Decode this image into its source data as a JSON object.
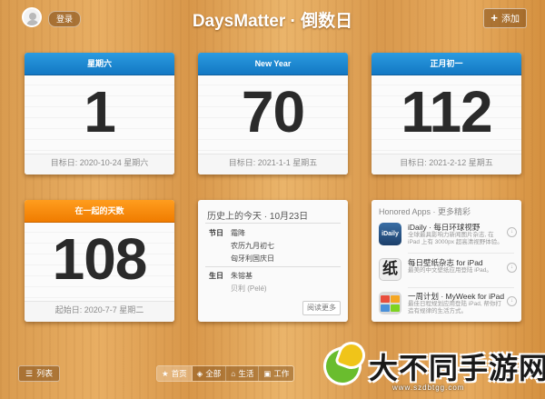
{
  "header": {
    "login_label": "登录",
    "title": "DaysMatter · 倒数日",
    "add_label": "添加"
  },
  "cards": [
    {
      "header": "星期六",
      "number": "1",
      "subtitle": "目标日: 2020-10-24 星期六",
      "color": "#1a86d2"
    },
    {
      "header": "New Year",
      "number": "70",
      "subtitle": "目标日: 2021-1-1 星期五",
      "color": "#1a86d2"
    },
    {
      "header": "正月初一",
      "number": "112",
      "subtitle": "目标日: 2021-2-12 星期五",
      "color": "#1a86d2"
    },
    {
      "header": "在一起的天数",
      "number": "108",
      "subtitle": "起始日: 2020-7-7 星期二",
      "color": "#f28500"
    }
  ],
  "history": {
    "title": "历史上的今天 · 10月23日",
    "festival_label": "节日",
    "festival_items": [
      "霜降",
      "农历九月初七",
      "匈牙利国庆日"
    ],
    "birthday_label": "生日",
    "birthday_items": [
      "朱镕基",
      "贝利 (Pelé)"
    ],
    "more_label": "阅读更多"
  },
  "honored_apps": {
    "title": "Honored Apps · 更多精彩",
    "apps": [
      {
        "name": "iDaily · 每日环球视野",
        "desc": "全球最具影响力新闻图片杂志, 在 iPad 上有 3000px 超高清视野体验。",
        "icon": "idaily-icon",
        "icon_text": "iDaily"
      },
      {
        "name": "每日壁纸杂志 for iPad",
        "desc": "最美的中文壁纸应用登陆 iPad。",
        "icon": "paper-icon",
        "icon_text": "纸"
      },
      {
        "name": "一周计划 · MyWeek for iPad",
        "desc": "最佳日程规划应用登陆 iPad, 帮你打造有规律的生活方式。",
        "icon": "myweek-icon",
        "icon_text": ""
      }
    ]
  },
  "bottom": {
    "list_label": "列表",
    "tabs": [
      {
        "label": "首页",
        "icon": "star-icon"
      },
      {
        "label": "全部",
        "icon": "layers-icon"
      },
      {
        "label": "生活",
        "icon": "home-icon"
      },
      {
        "label": "工作",
        "icon": "briefcase-icon"
      }
    ]
  },
  "watermark": {
    "text": "大不同手游网",
    "url": "www.szdbtgg.com"
  }
}
